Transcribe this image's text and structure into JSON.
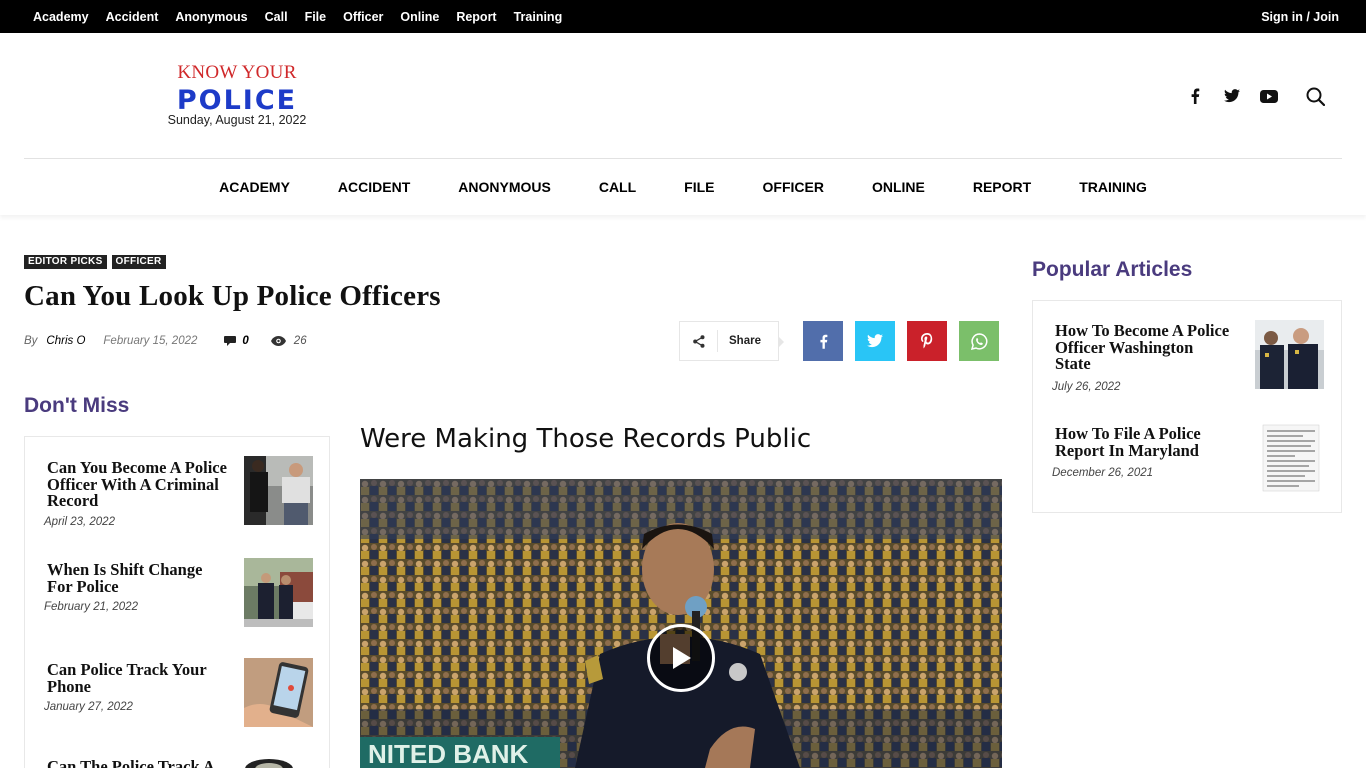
{
  "topbar": {
    "menu": [
      "Academy",
      "Accident",
      "Anonymous",
      "Call",
      "File",
      "Officer",
      "Online",
      "Report",
      "Training"
    ],
    "signin": "Sign in / Join"
  },
  "logo": {
    "line1": "KNOW YOUR",
    "line2": "POLICE",
    "date": "Sunday, August 21, 2022"
  },
  "nav": [
    "ACADEMY",
    "ACCIDENT",
    "ANONYMOUS",
    "CALL",
    "FILE",
    "OFFICER",
    "ONLINE",
    "REPORT",
    "TRAINING"
  ],
  "social_icons": [
    "facebook-icon",
    "twitter-icon",
    "youtube-icon",
    "search-icon"
  ],
  "article": {
    "categories": [
      "EDITOR PICKS",
      "OFFICER"
    ],
    "title": "Can You Look Up Police Officers",
    "by": "By",
    "author": "Chris O",
    "date": "February 15, 2022",
    "comments": "0",
    "views": "26",
    "share_label": "Share",
    "subheading": "Were Making Those Records Public"
  },
  "share_colors": {
    "facebook": "#516eab",
    "twitter": "#29c5f6",
    "pinterest": "#ca212a",
    "whatsapp": "#7bbf6a"
  },
  "dont_miss": {
    "title": "Don't Miss",
    "items": [
      {
        "title": "Can You Become A Police Officer With A Criminal Record",
        "date": "April 23, 2022"
      },
      {
        "title": "When Is Shift Change For Police",
        "date": "February 21, 2022"
      },
      {
        "title": "Can Police Track Your Phone",
        "date": "January 27, 2022"
      },
      {
        "title": "Can The Police Track A",
        "date": ""
      }
    ]
  },
  "popular": {
    "title": "Popular Articles",
    "items": [
      {
        "title": "How To Become A Police Officer Washington State",
        "date": "July 26, 2022"
      },
      {
        "title": "How To File A Police Report In Maryland",
        "date": "December 26, 2021"
      }
    ]
  },
  "colors": {
    "accent": "#4a3b7e",
    "logo_red": "#d0282a",
    "logo_blue": "#1d3bc8"
  }
}
